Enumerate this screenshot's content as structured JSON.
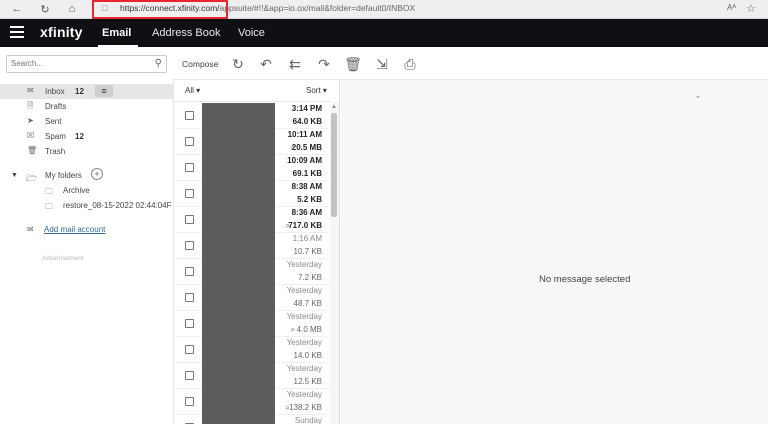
{
  "browser": {
    "url_host": "https://connect.xfinity.com/",
    "url_path": "appsuite/#!!&app=io.ox/mail&folder=default0/INBOX",
    "reader_label": "Aᴬ"
  },
  "header": {
    "logo": "xfinity",
    "tabs": [
      "Email",
      "Address Book",
      "Voice"
    ]
  },
  "sidebar": {
    "search_placeholder": "Search...",
    "folders": [
      {
        "label": "Inbox",
        "count": "12",
        "icon": "inbox-icon"
      },
      {
        "label": "Drafts",
        "count": "",
        "icon": "drafts-icon"
      },
      {
        "label": "Sent",
        "count": "",
        "icon": "sent-icon"
      },
      {
        "label": "Spam",
        "count": "12",
        "icon": "spam-icon"
      },
      {
        "label": "Trash",
        "count": "",
        "icon": "trash-icon"
      }
    ],
    "my_folders_label": "My folders",
    "subfolders": [
      "Archive",
      "restore_08-15-2022 02:44:04F"
    ],
    "add_mail_account": "Add mail account",
    "advertisement": "Advertisement"
  },
  "toolbar": {
    "compose": "Compose",
    "icons": [
      "refresh-icon",
      "reply-icon",
      "reply-all-icon",
      "forward-icon",
      "delete-icon",
      "move-icon",
      "print-icon"
    ]
  },
  "list": {
    "filter": "All",
    "sort": "Sort",
    "messages": [
      {
        "date": "3:14 PM",
        "size": "64.0 KB",
        "unread": true,
        "attachment": false
      },
      {
        "date": "10:11 AM",
        "size": "20.5 MB",
        "unread": true,
        "attachment": true
      },
      {
        "date": "10:09 AM",
        "size": "69.1 KB",
        "unread": true,
        "attachment": false
      },
      {
        "date": "8:38 AM",
        "size": "5.2 KB",
        "unread": true,
        "attachment": false
      },
      {
        "date": "8:36 AM",
        "size": "717.0 KB",
        "unread": true,
        "attachment": true
      },
      {
        "date": "1:16 AM",
        "size": "10.7 KB",
        "unread": false,
        "attachment": false
      },
      {
        "date": "Yesterday",
        "size": "7.2 KB",
        "unread": false,
        "attachment": false
      },
      {
        "date": "Yesterday",
        "size": "48.7 KB",
        "unread": false,
        "attachment": false
      },
      {
        "date": "Yesterday",
        "size": "4.0 MB",
        "unread": false,
        "attachment": true
      },
      {
        "date": "Yesterday",
        "size": "14.0 KB",
        "unread": false,
        "attachment": false
      },
      {
        "date": "Yesterday",
        "size": "12.5 KB",
        "unread": false,
        "attachment": false
      },
      {
        "date": "Yesterday",
        "size": "138.2 KB",
        "unread": false,
        "attachment": true
      },
      {
        "date": "Sunday",
        "size": "",
        "unread": false,
        "attachment": false
      }
    ]
  },
  "reading_pane": {
    "empty_text": "No message selected"
  }
}
